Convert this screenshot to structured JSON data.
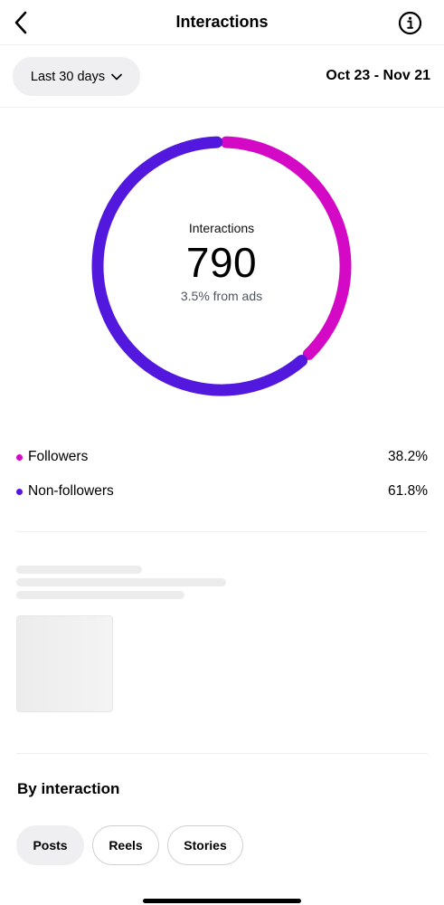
{
  "header": {
    "title": "Interactions"
  },
  "filter": {
    "range_label": "Last 30 days",
    "date_range": "Oct 23 - Nov 21"
  },
  "summary": {
    "label": "Interactions",
    "value": "790",
    "sub": "3.5% from ads"
  },
  "chart_data": {
    "type": "pie",
    "categories": [
      "Followers",
      "Non-followers"
    ],
    "values": [
      38.2,
      61.8
    ],
    "colors": [
      "#d409c6",
      "#5318dd"
    ]
  },
  "legend": [
    {
      "name": "Followers",
      "percent": "38.2%",
      "color": "#d409c6"
    },
    {
      "name": "Non-followers",
      "percent": "61.8%",
      "color": "#5318dd"
    }
  ],
  "section": {
    "title": "By interaction"
  },
  "tabs": [
    {
      "label": "Posts",
      "active": true
    },
    {
      "label": "Reels",
      "active": false
    },
    {
      "label": "Stories",
      "active": false
    }
  ],
  "icons": {
    "back": "chevron-left-icon",
    "info": "info-circle-icon",
    "dropdown": "chevron-down-icon"
  }
}
